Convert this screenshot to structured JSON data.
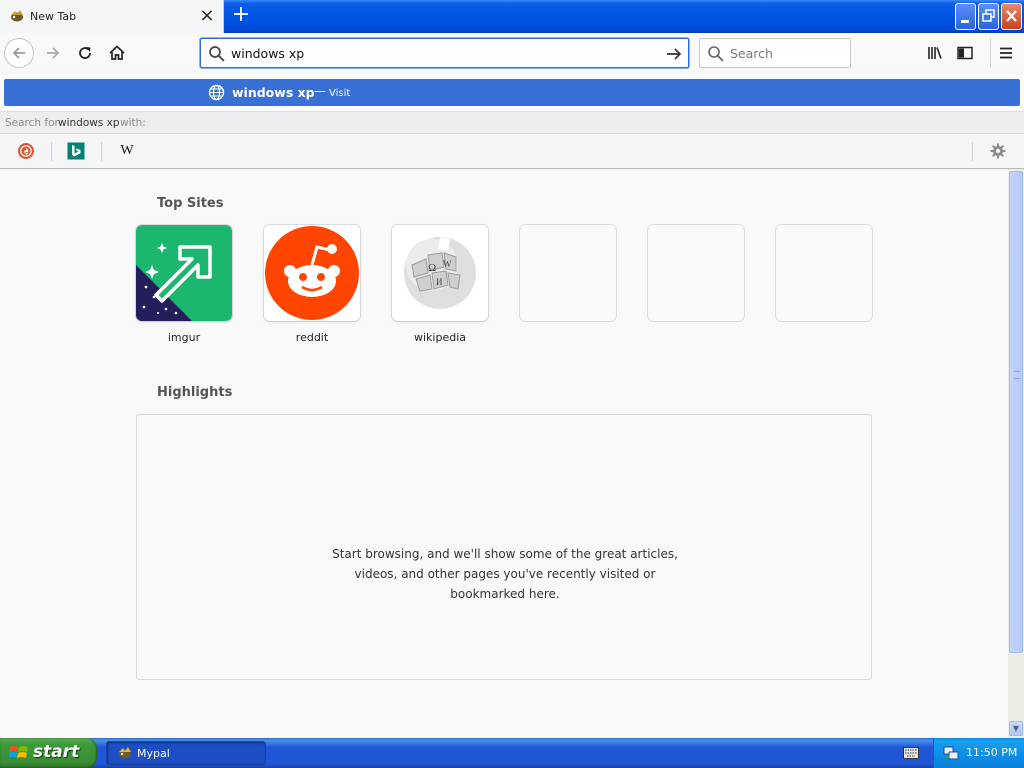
{
  "browser": {
    "tab": {
      "title": "New Tab"
    },
    "urlbar": {
      "value": "windows xp"
    },
    "searchbar": {
      "placeholder": "Search"
    }
  },
  "url_popup": {
    "suggestion": {
      "term": "windows xp",
      "separator": "—",
      "action": "Visit"
    },
    "search_with": {
      "prefix": "Search for",
      "term": "windows xp",
      "suffix": "with:"
    },
    "engines": [
      {
        "name": "DuckDuckGo",
        "icon": "duckduckgo-icon"
      },
      {
        "name": "Bing",
        "icon": "bing-icon"
      },
      {
        "name": "Wikipedia",
        "icon": "wikipedia-w-icon",
        "glyph": "W"
      }
    ]
  },
  "newtab": {
    "top_sites_title": "Top Sites",
    "top_sites": [
      {
        "label": "imgur",
        "icon": "imgur-icon",
        "color": "#1bb76e"
      },
      {
        "label": "reddit",
        "icon": "reddit-icon",
        "color": "#ff4500"
      },
      {
        "label": "wikipedia",
        "icon": "wikipedia-globe-icon"
      }
    ],
    "highlights_title": "Highlights",
    "highlights_empty_message": "Start browsing, and we'll show some of the great articles, videos, and other pages you've recently visited or bookmarked here."
  },
  "taskbar": {
    "start_label": "start",
    "tasks": [
      {
        "label": "Mypal"
      }
    ],
    "clock": "11:50 PM"
  },
  "colors": {
    "accent": "#3870d6",
    "titlebar": "#0055e5",
    "start_green": "#3c9a3c"
  }
}
